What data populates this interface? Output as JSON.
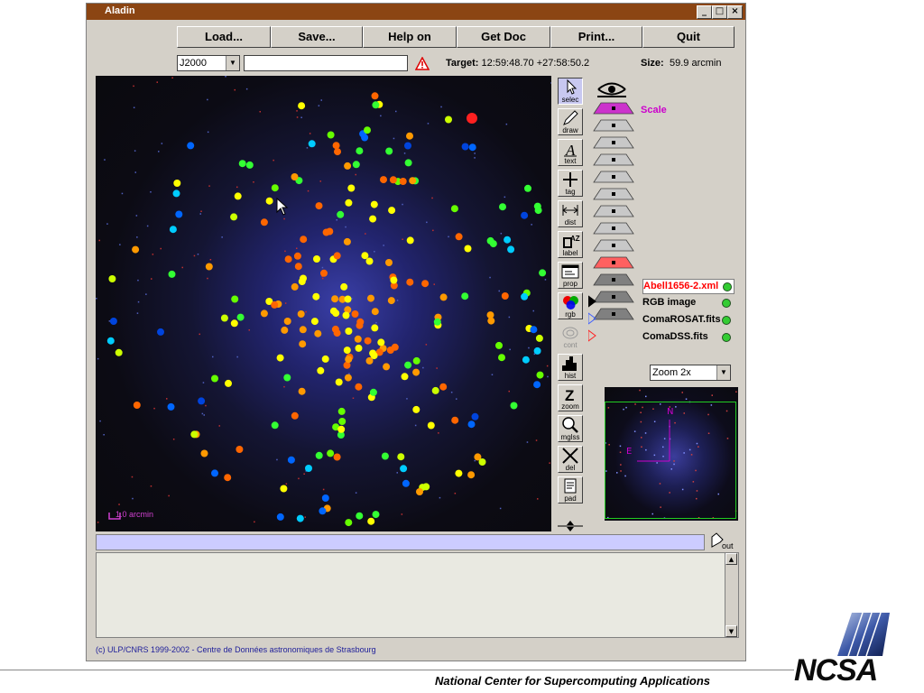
{
  "window": {
    "title": "Aladin"
  },
  "window_controls": {
    "minimize": "_",
    "maximize": "□",
    "close": "×"
  },
  "toolbar": {
    "load": "Load...",
    "save": "Save...",
    "help": "Help on",
    "getdoc": "Get Doc",
    "print": "Print...",
    "quit": "Quit"
  },
  "coord_frame": {
    "selected": "J2000"
  },
  "command_input": {
    "value": ""
  },
  "target": {
    "label": "Target:",
    "value": "12:59:48.70 +27:58:50.2"
  },
  "size": {
    "label": "Size:",
    "value": "59.9 arcmin"
  },
  "scale_bar": {
    "label": "1.0 arcmin"
  },
  "tools": [
    {
      "id": "select",
      "label": "selec",
      "icon": "cursor-arrow-icon",
      "active": true
    },
    {
      "id": "draw",
      "label": "draw",
      "icon": "pencil-icon"
    },
    {
      "id": "text",
      "label": "text",
      "icon": "letter-a-icon"
    },
    {
      "id": "tag",
      "label": "tag",
      "icon": "plus-icon"
    },
    {
      "id": "dist",
      "label": "dist",
      "icon": "distance-ruler-icon"
    },
    {
      "id": "label",
      "label": "label",
      "icon": "label-az-icon"
    },
    {
      "id": "prop",
      "label": "prop",
      "icon": "properties-window-icon"
    },
    {
      "id": "rgb",
      "label": "rgb",
      "icon": "rgb-circles-icon"
    },
    {
      "id": "cont",
      "label": "cont",
      "icon": "contour-icon",
      "disabled": true
    },
    {
      "id": "hist",
      "label": "hist",
      "icon": "histogram-icon"
    },
    {
      "id": "zoom",
      "label": "zoom",
      "icon": "letter-z-icon"
    },
    {
      "id": "mglss",
      "label": "mglss",
      "icon": "magnifier-icon"
    },
    {
      "id": "del",
      "label": "del",
      "icon": "delete-x-icon"
    },
    {
      "id": "pad",
      "label": "pad",
      "icon": "notepad-icon"
    }
  ],
  "stack": {
    "scale_label": "Scale",
    "layers": [
      {
        "name": "Abell1656-2.xml",
        "color": "#ff0000",
        "highlight": true
      },
      {
        "name": "RGB image",
        "color": "#000000"
      },
      {
        "name": "ComaROSAT.fits",
        "color": "#000000"
      },
      {
        "name": "ComaDSS.fits",
        "color": "#000000"
      }
    ]
  },
  "zoom_select": {
    "selected": "Zoom 2x"
  },
  "compass": {
    "north": "N",
    "east": "E"
  },
  "out_button": {
    "label": "out"
  },
  "console": {
    "text": ""
  },
  "copyright": "(c) ULP/CNRS 1999-2002 - Centre de Données astronomiques de Strasbourg",
  "footer": {
    "org_text": "National Center for Supercomputing Applications",
    "logo_text": "NCSA"
  },
  "colors": {
    "titlebar": "#8b4513",
    "status_bar": "#ccccff",
    "scale_label": "#cc00cc",
    "highlight_layer": "#ff0000"
  }
}
